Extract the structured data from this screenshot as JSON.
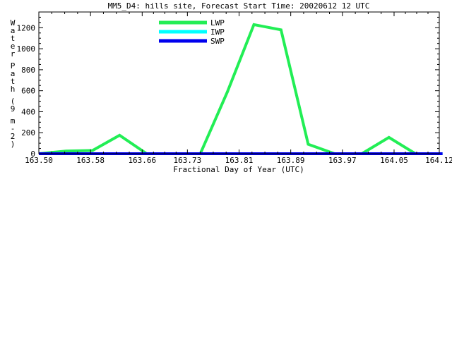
{
  "chart_data": {
    "type": "line",
    "title": "MM5_D4: hills site,  Forecast Start Time: 20020612 12 UTC",
    "xlabel": "Fractional Day of Year (UTC)",
    "ylabel": "Water Path (g m-2)",
    "ylabel_display": "Water Path (9 m-2)",
    "xlim": [
      163.5,
      164.12
    ],
    "ylim": [
      0,
      1350
    ],
    "x_ticks": [
      "163.50",
      "163.58",
      "163.66",
      "163.73",
      "163.81",
      "163.89",
      "163.97",
      "164.05",
      "164.12"
    ],
    "y_ticks": [
      "0",
      "200",
      "400",
      "600",
      "800",
      "1000",
      "1200"
    ],
    "legend_position": "top-left",
    "grid": false,
    "x": [
      163.5,
      163.542,
      163.583,
      163.625,
      163.667,
      163.708,
      163.75,
      163.792,
      163.833,
      163.875,
      163.917,
      163.958,
      164.0,
      164.042,
      164.083,
      164.125
    ],
    "series": [
      {
        "name": "LWP",
        "color": "#22ee55",
        "values": [
          0,
          25,
          30,
          175,
          0,
          0,
          0,
          590,
          1230,
          1180,
          90,
          0,
          0,
          155,
          0,
          0
        ]
      },
      {
        "name": "IWP",
        "color": "#00ffff",
        "values": [
          0,
          0,
          0,
          0,
          0,
          0,
          0,
          0,
          0,
          0,
          0,
          0,
          0,
          0,
          0,
          0
        ]
      },
      {
        "name": "SWP",
        "color": "#0000ee",
        "values": [
          0,
          0,
          0,
          0,
          0,
          0,
          0,
          0,
          0,
          0,
          0,
          0,
          0,
          0,
          0,
          0
        ]
      }
    ]
  }
}
